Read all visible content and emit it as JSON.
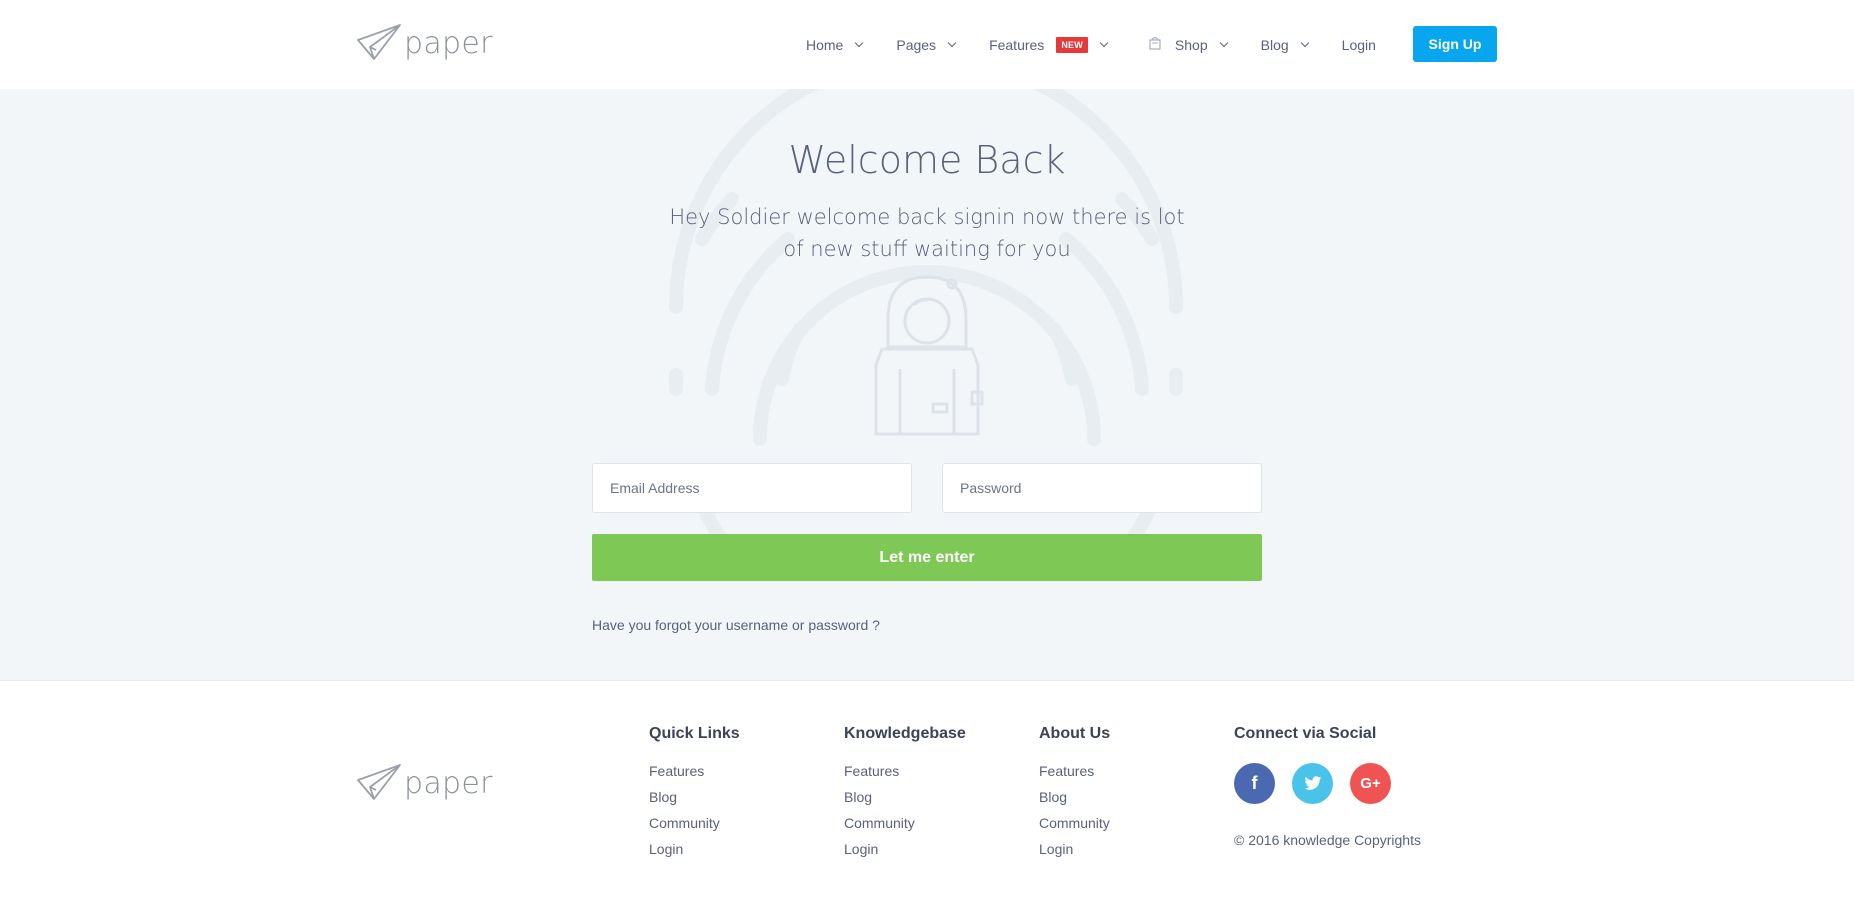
{
  "brand": {
    "name": "paper"
  },
  "nav": {
    "items": [
      {
        "label": "Home"
      },
      {
        "label": "Pages"
      },
      {
        "label": "Features",
        "badge": "NEW"
      },
      {
        "label": "Shop"
      },
      {
        "label": "Blog"
      },
      {
        "label": "Login"
      }
    ],
    "signup_label": "Sign Up"
  },
  "hero": {
    "title": "Welcome Back",
    "subtitle": "Hey Soldier welcome back signin now there is lot of new stuff waiting for you",
    "email_placeholder": "Email Address",
    "password_placeholder": "Password",
    "submit_label": "Let me enter",
    "forgot_text": "Have you forgot your username or password ?"
  },
  "footer": {
    "columns": [
      {
        "title": "Quick Links",
        "links": [
          "Features",
          "Blog",
          "Community",
          "Login"
        ]
      },
      {
        "title": "Knowledgebase",
        "links": [
          "Features",
          "Blog",
          "Community",
          "Login"
        ]
      },
      {
        "title": "About Us",
        "links": [
          "Features",
          "Blog",
          "Community",
          "Login"
        ]
      }
    ],
    "social": {
      "title": "Connect via Social",
      "icons": [
        {
          "name": "facebook-icon",
          "glyph": "f",
          "color": "#4b69b0"
        },
        {
          "name": "twitter-icon",
          "color": "#4ac3ea"
        },
        {
          "name": "google-plus-icon",
          "glyph": "G+",
          "color": "#ef5353"
        }
      ]
    },
    "copyright": "© 2016 knowledge Copyrights"
  },
  "colors": {
    "accent_blue": "#08a6ef",
    "submit_green": "#7ec855",
    "badge_red": "#e63a3a",
    "hero_bg": "#f3f6f9"
  }
}
